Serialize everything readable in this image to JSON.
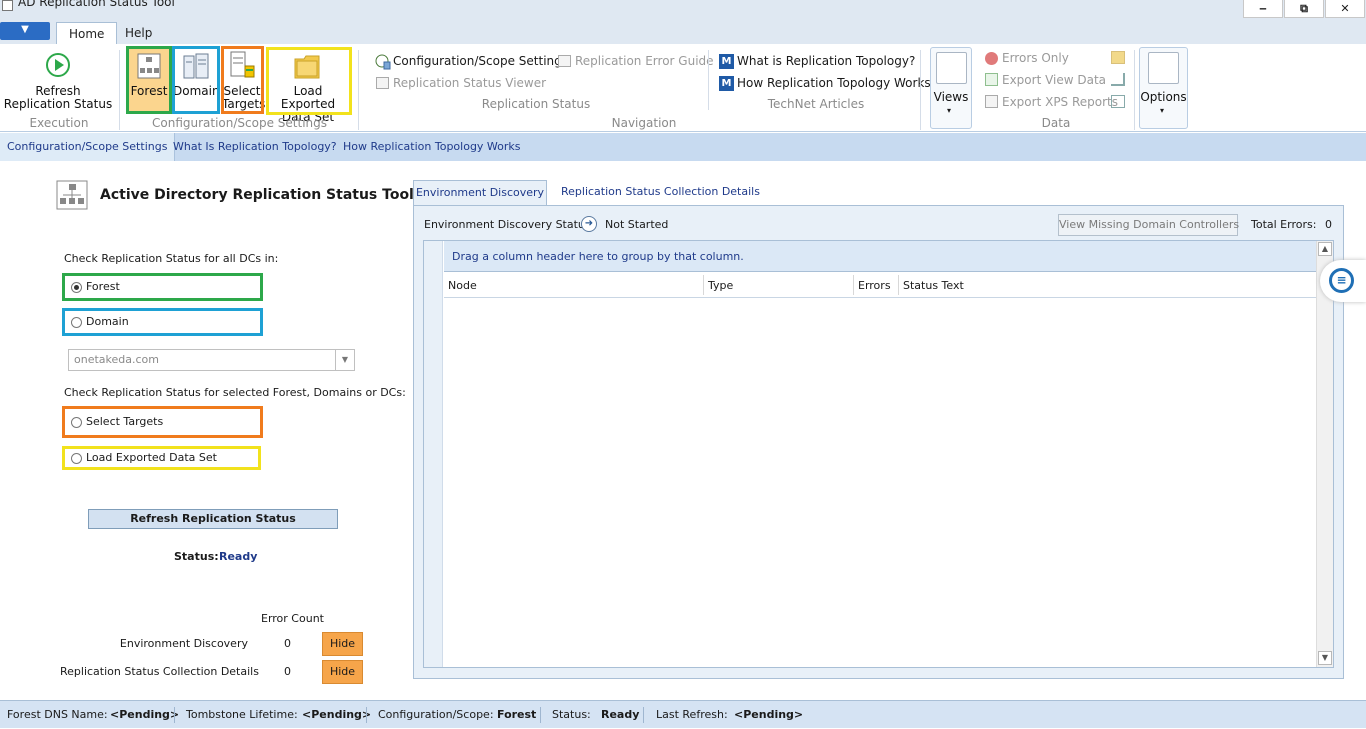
{
  "window": {
    "title": "AD Replication Status Tool",
    "minimize": "‒",
    "restore": "⧉",
    "close": "✕"
  },
  "ribbon_tabs": {
    "menu_arrow": "▼",
    "home": "Home",
    "help": "Help"
  },
  "ribbon": {
    "execution": {
      "refresh_label": "Refresh Replication Status",
      "group": "Execution"
    },
    "scope": {
      "forest": "Forest",
      "domain": "Domain",
      "select_targets": "Select Targets",
      "load_exported": "Load Exported Data Set",
      "group": "Configuration/Scope Settings"
    },
    "navigation": {
      "config_scope": "Configuration/Scope Settings",
      "error_guide": "Replication Error Guide",
      "status_viewer": "Replication Status Viewer",
      "status_group": "Replication Status",
      "group": "Navigation"
    },
    "technet": {
      "what_is": "What is Replication Topology?",
      "how_works": "How Replication Topology Works",
      "group": "TechNet Articles"
    },
    "data": {
      "views": "Views",
      "errors_only": "Errors Only",
      "export_view": "Export View Data",
      "export_xps": "Export XPS Reports",
      "group": "Data"
    },
    "options": "Options"
  },
  "subtabs": [
    "Configuration/Scope Settings",
    "What Is Replication Topology?",
    "How Replication Topology Works"
  ],
  "left": {
    "title": "Active Directory Replication Status Tool",
    "check_all_label": "Check Replication Status for all DCs in:",
    "forest": "Forest",
    "domain": "Domain",
    "domain_value": "onetakeda.com",
    "check_selected_label": "Check Replication Status for selected Forest, Domains or DCs:",
    "select_targets": "Select Targets",
    "load_exported": "Load Exported Data Set",
    "refresh_button": "Refresh Replication Status",
    "status_label": "Status:",
    "status_value": "Ready",
    "error_count_header": "Error Count",
    "env_discovery_label": "Environment Discovery",
    "env_discovery_count": "0",
    "collection_label": "Replication Status Collection Details",
    "collection_count": "0",
    "hide": "Hide"
  },
  "right": {
    "tabs": [
      "Environment Discovery",
      "Replication Status Collection Details"
    ],
    "discovery_status_label": "Environment Discovery Status:",
    "discovery_status_value": "Not Started",
    "view_missing_dcs": "View Missing Domain Controllers",
    "total_errors_label": "Total Errors:",
    "total_errors_value": "0",
    "group_hint": "Drag a column header here to group by that column.",
    "columns": [
      "Node",
      "Type",
      "Errors",
      "Status Text"
    ]
  },
  "statusbar": {
    "forest_dns_label": "Forest DNS Name:",
    "forest_dns_value": "<Pending>",
    "tombstone_label": "Tombstone Lifetime:",
    "tombstone_value": "<Pending>",
    "config_label": "Configuration/Scope:",
    "config_value": "Forest",
    "status_label": "Status:",
    "status_value": "Ready",
    "last_refresh_label": "Last Refresh:",
    "last_refresh_value": "<Pending>"
  },
  "colors": {
    "accent": "#2b6cc4",
    "green": "#2da84a",
    "blue": "#1ea1d4",
    "orange": "#f07b1d",
    "yellow": "#f2e21c",
    "hide_button": "#f6a54a"
  }
}
